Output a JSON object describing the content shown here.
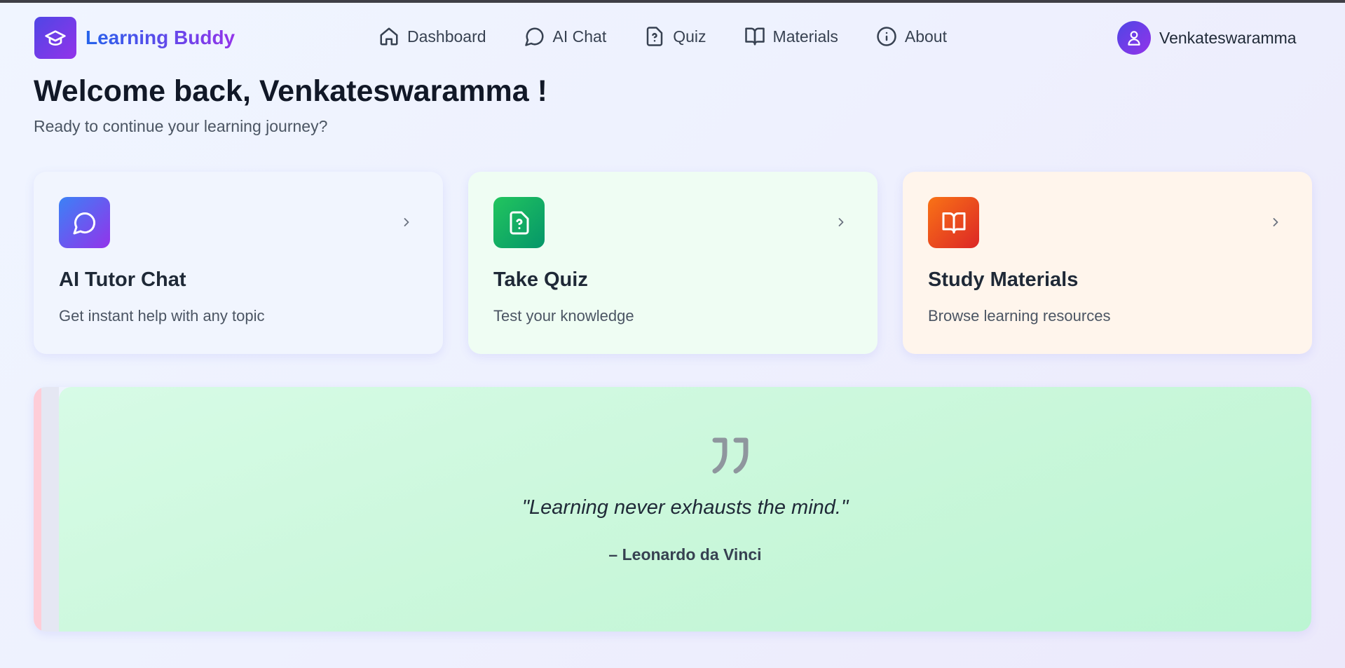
{
  "app": {
    "name": "Learning Buddy"
  },
  "nav": {
    "items": [
      {
        "label": "Dashboard",
        "icon": "home-icon"
      },
      {
        "label": "AI Chat",
        "icon": "chat-icon"
      },
      {
        "label": "Quiz",
        "icon": "quiz-file-icon"
      },
      {
        "label": "Materials",
        "icon": "book-icon"
      },
      {
        "label": "About",
        "icon": "info-icon"
      }
    ]
  },
  "user": {
    "name": "Venkateswaramma",
    "icon": "user-icon"
  },
  "welcome": {
    "title": "Welcome back, Venkateswaramma !",
    "subtitle": "Ready to continue your learning journey?"
  },
  "cards": [
    {
      "title": "AI Tutor Chat",
      "description": "Get instant help with any topic",
      "icon": "chat-icon",
      "background": "#f1f5fe",
      "icon_gradient": [
        "#3b82f6",
        "#9333ea"
      ]
    },
    {
      "title": "Take Quiz",
      "description": "Test your knowledge",
      "icon": "quiz-file-icon",
      "background": "#effdf3",
      "icon_gradient": [
        "#22c55e",
        "#059669"
      ]
    },
    {
      "title": "Study Materials",
      "description": "Browse learning resources",
      "icon": "book-icon",
      "background": "#fff5ec",
      "icon_gradient": [
        "#f97316",
        "#dc2626"
      ]
    }
  ],
  "quote": {
    "text": "\"Learning never exhausts the mind.\"",
    "author": "– Leonardo da Vinci",
    "icon": "quote-icon"
  },
  "colors": {
    "brand_gradient": [
      "#2563eb",
      "#9333ea"
    ],
    "quote_background": "#ccf8de"
  }
}
